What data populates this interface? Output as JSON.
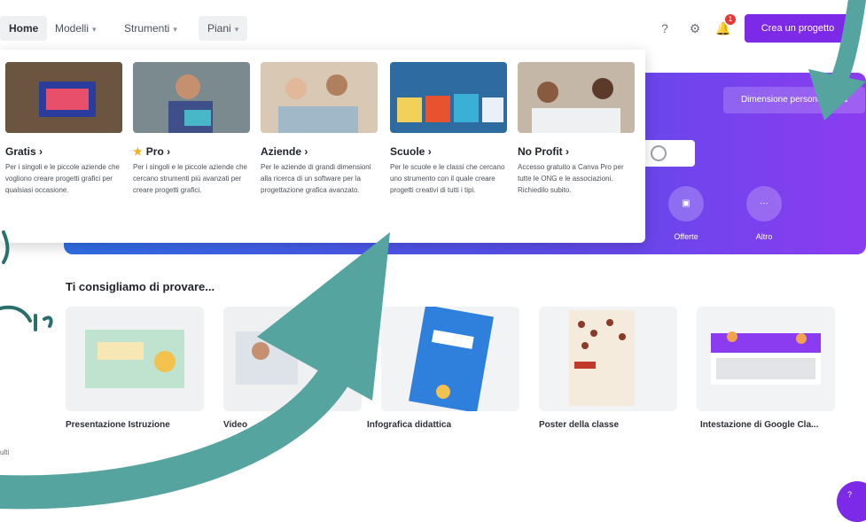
{
  "nav": {
    "home": "Home",
    "models": "Modelli",
    "tools": "Strumenti",
    "plans": "Piani",
    "create_button": "Crea un progetto",
    "notification_count": "1"
  },
  "hero": {
    "custom_size_button": "Dimensione personalizzata",
    "categories": [
      {
        "label": "Offerte"
      },
      {
        "label": "Altro"
      }
    ]
  },
  "plans_menu": [
    {
      "title": "Gratis",
      "desc": "Per i singoli e le piccole aziende che vogliono creare progetti grafici per qualsiasi occasione."
    },
    {
      "title": "Pro",
      "desc": "Per i singoli e le piccole aziende che cercano strumenti più avanzati per creare progetti grafici."
    },
    {
      "title": "Aziende",
      "desc": "Per le aziende di grandi dimensioni alla ricerca di un software per la progettazione grafica avanzato."
    },
    {
      "title": "Scuole",
      "desc": "Per le scuole e le classi che cercano uno strumento con il quale creare progetti creativi di tutti i tipi."
    },
    {
      "title": "No Profit",
      "desc": "Accesso gratuito a Canva Pro per tutte le ONG e le associazioni. Richiedilo subito."
    }
  ],
  "recommend": {
    "title": "Ti consigliamo di provare...",
    "cards": [
      {
        "label": "Presentazione Istruzione"
      },
      {
        "label": "Video"
      },
      {
        "label": "Infografica didattica"
      },
      {
        "label": "Poster della classe"
      },
      {
        "label": "Intestazione di Google Cla..."
      }
    ]
  },
  "footer_text": "ulti",
  "colors": {
    "accent": "#7d2ae8",
    "hero_start": "#2f6de6",
    "hero_end": "#8b3cf0",
    "arrow": "#55a4a0"
  }
}
